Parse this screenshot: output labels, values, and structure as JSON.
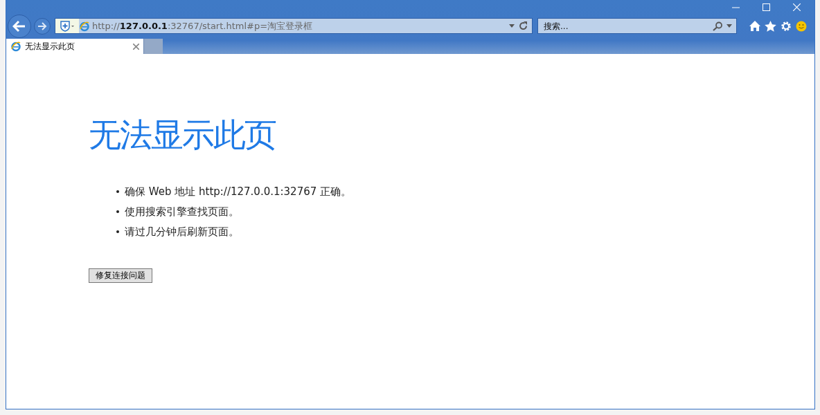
{
  "address_bar": {
    "url": "http://**127.0.0.1**:32767/start.html#p=淘宝登录框"
  },
  "search": {
    "placeholder": "搜索..."
  },
  "tabs": [
    {
      "label": "无法显示此页",
      "selected": true
    }
  ],
  "page": {
    "heading": "无法显示此页",
    "suggestions": [
      "确保 Web 地址 http://127.0.0.1:32767 正确。",
      "使用搜索引擎查找页面。",
      "请过几分钟后刷新页面。"
    ],
    "button": "修复连接问题"
  }
}
